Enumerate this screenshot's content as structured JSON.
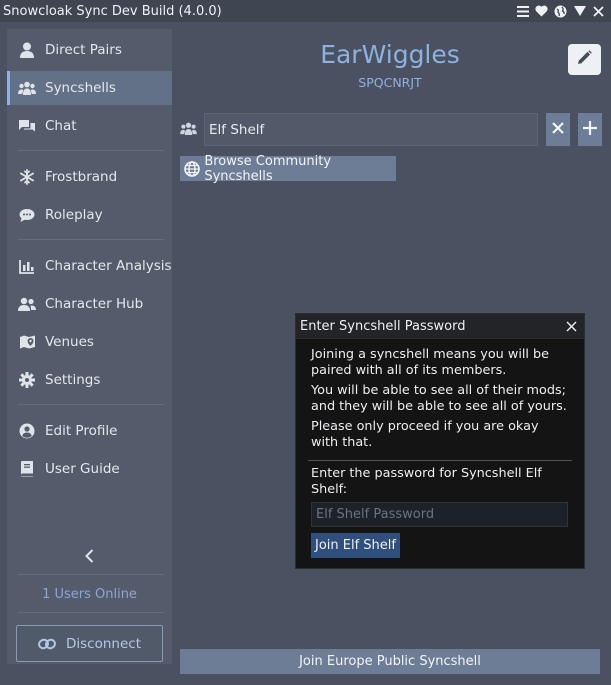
{
  "window": {
    "title": "Snowcloak Sync Dev Build (4.0.0)"
  },
  "titlebar_icons": [
    "menu-icon",
    "heart-icon",
    "globe-icon",
    "collapse-triangle-icon",
    "close-icon"
  ],
  "sidebar": {
    "items": [
      {
        "label": "Direct Pairs",
        "icon": "user-icon"
      },
      {
        "label": "Syncshells",
        "icon": "users-group-icon",
        "active": true
      },
      {
        "label": "Chat",
        "icon": "chat-bubbles-icon"
      },
      {
        "label": "Frostbrand",
        "icon": "snowflake-icon"
      },
      {
        "label": "Roleplay",
        "icon": "speech-bubble-icon"
      },
      {
        "label": "Character Analysis",
        "icon": "bar-chart-icon"
      },
      {
        "label": "Character Hub",
        "icon": "user-group-icon"
      },
      {
        "label": "Venues",
        "icon": "map-marker-icon"
      },
      {
        "label": "Settings",
        "icon": "gear-icon"
      },
      {
        "label": "Edit Profile",
        "icon": "user-circle-icon"
      },
      {
        "label": "User Guide",
        "icon": "book-icon"
      }
    ],
    "users_online": "1 Users Online",
    "disconnect_label": "Disconnect"
  },
  "profile": {
    "name": "EarWiggles",
    "uid": "SPQCNRJT"
  },
  "syncshell_search": {
    "value": "Elf Shelf"
  },
  "browse_button_label": "Browse Community Syncshells",
  "join_public_label": "Join Europe Public Syncshell",
  "modal": {
    "title": "Enter Syncshell Password",
    "paragraphs": [
      "Joining a syncshell means you will be paired with all of its members.",
      "You will be able to see all of their mods; and they will be able to see all of yours.",
      "Please only proceed if you are okay with that."
    ],
    "password_prompt": "Enter the password for Syncshell Elf Shelf:",
    "password_placeholder": "Elf Shelf Password",
    "join_button_label": "Join Elf Shelf"
  },
  "colors": {
    "background": "#4a5160",
    "sidebar": "#545c6b",
    "accent": "#8fb1e0",
    "button": "#6d7d96",
    "modal_background": "#141414",
    "modal_button": "#2f4f7c"
  }
}
